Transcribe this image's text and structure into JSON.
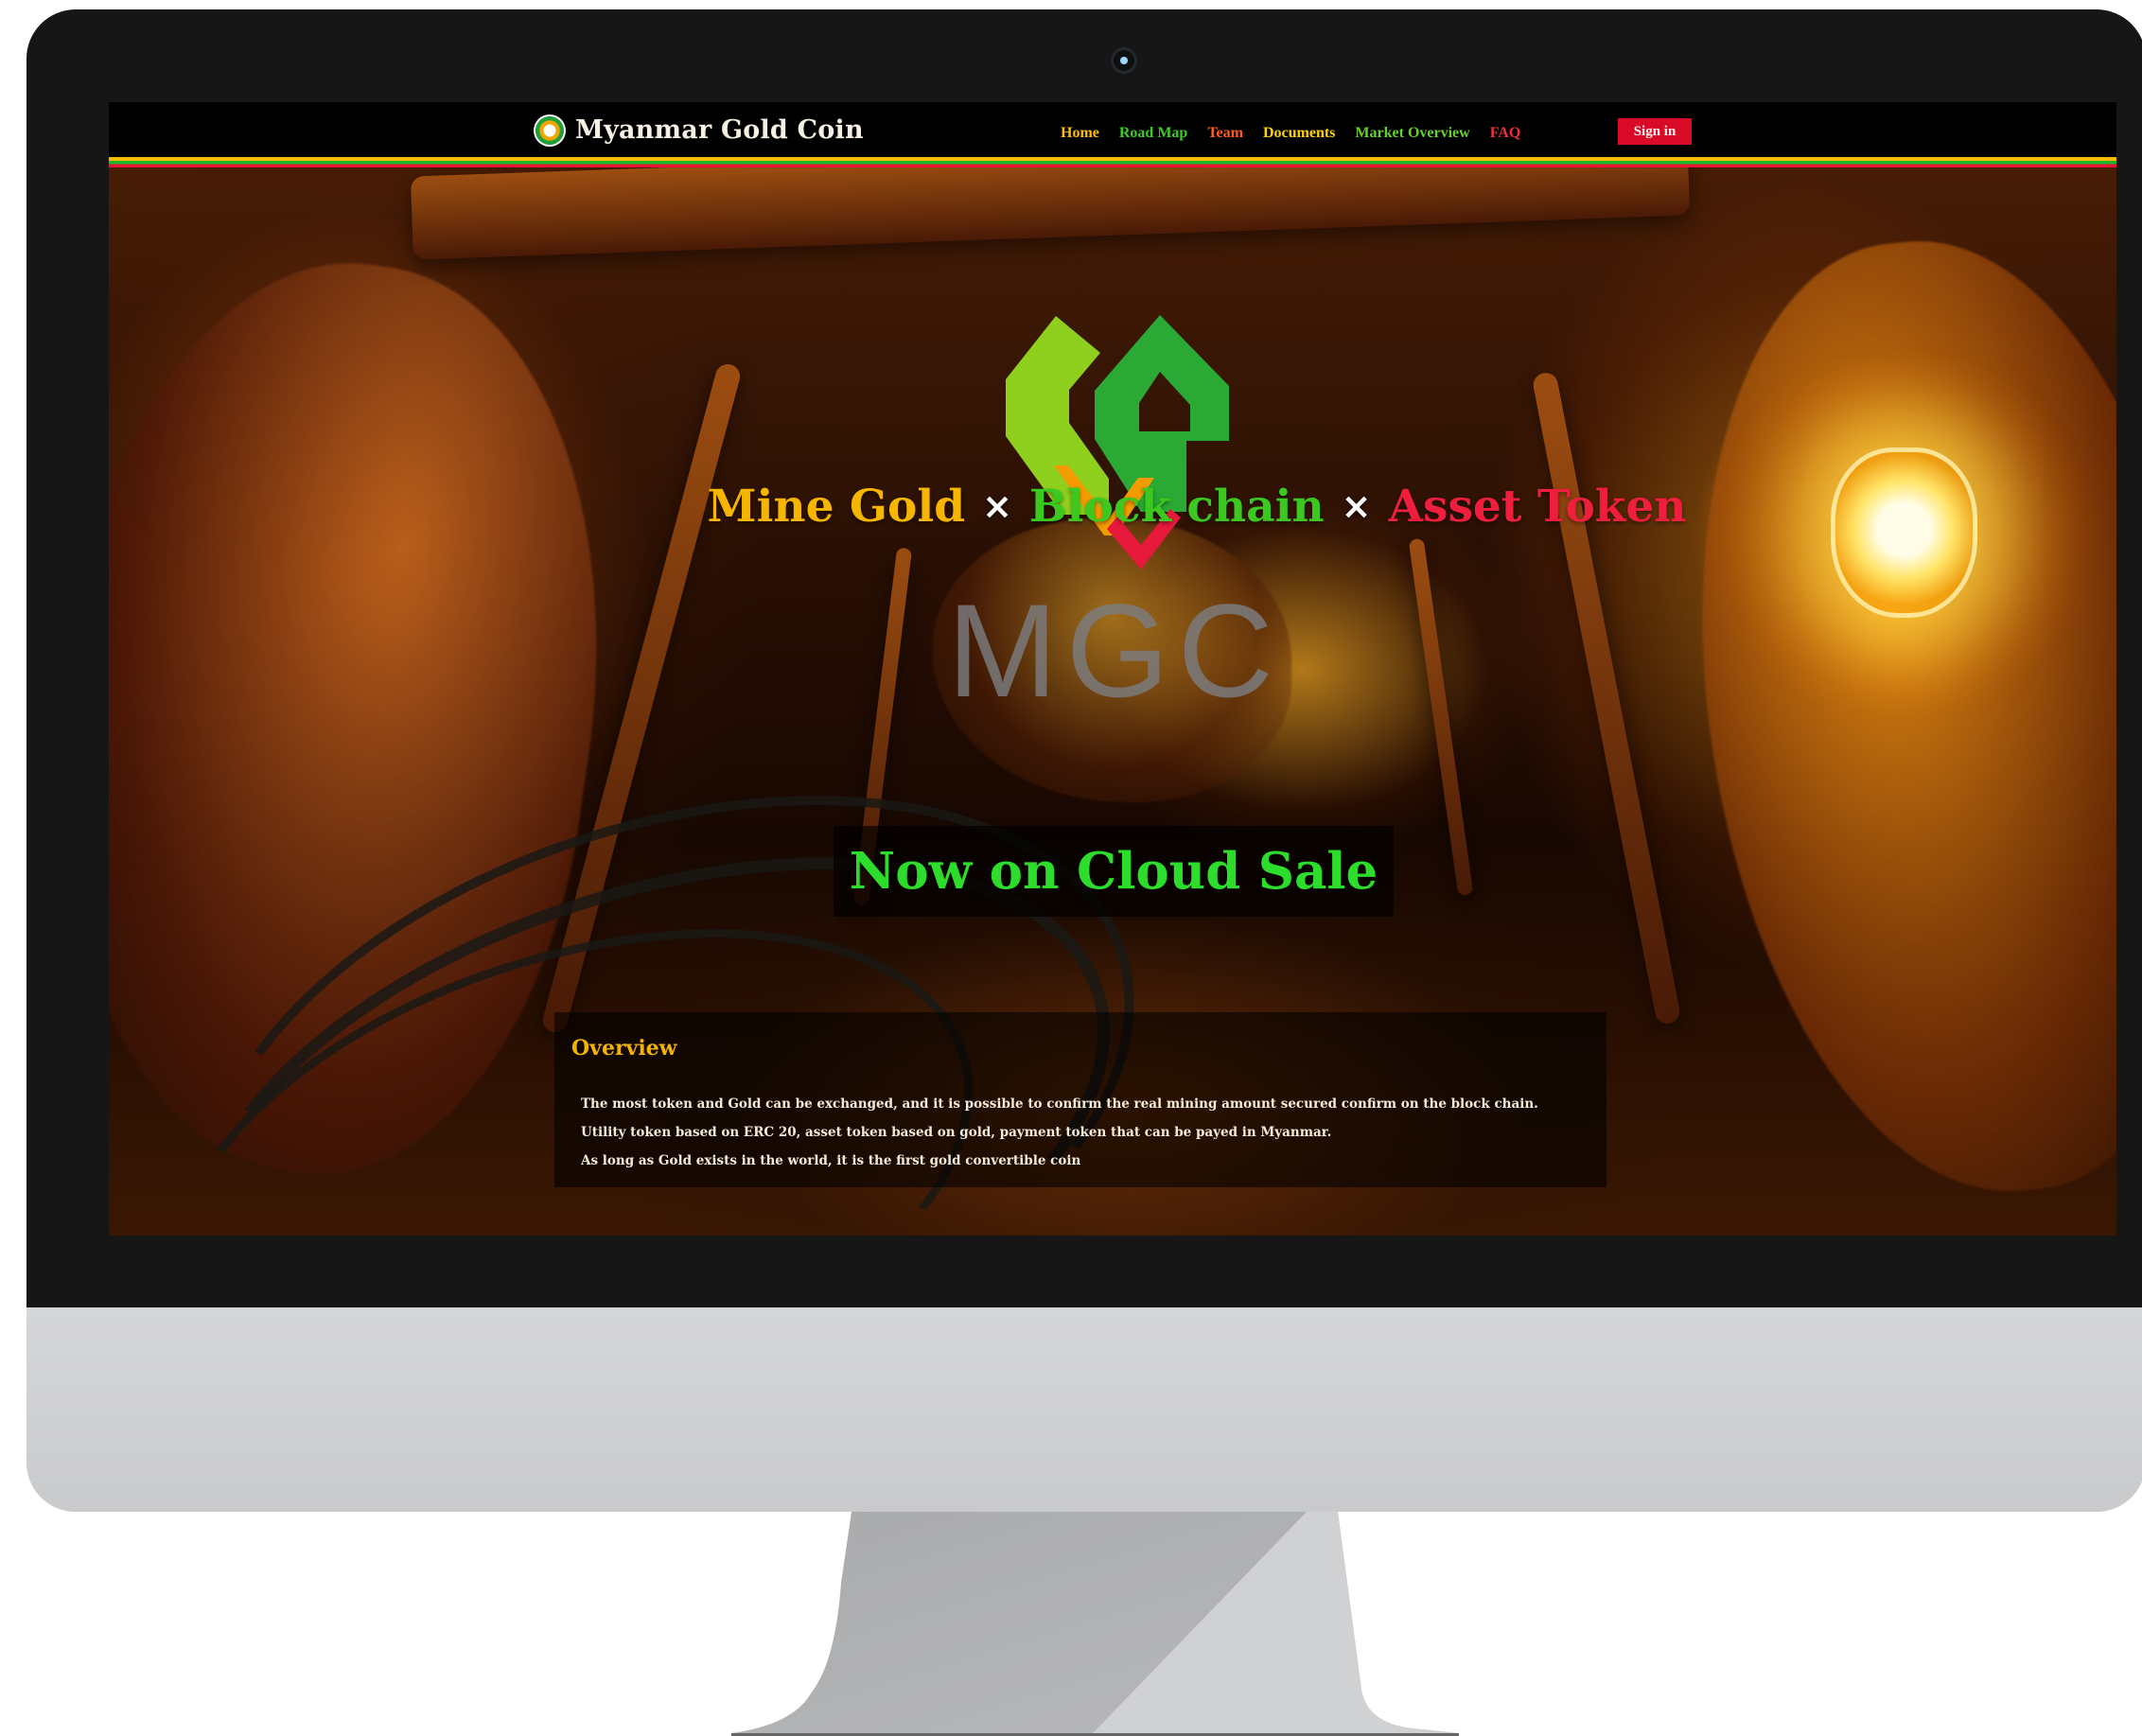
{
  "brand": {
    "name": "Myanmar Gold Coin",
    "logo_icon": "mgc-coin-icon"
  },
  "nav": {
    "items": [
      {
        "label": "Home",
        "color": "#ffbf00"
      },
      {
        "label": "Road Map",
        "color": "#3ecd24"
      },
      {
        "label": "Team",
        "color": "#ff5d1a"
      },
      {
        "label": "Documents",
        "color": "#ffd500"
      },
      {
        "label": "Market Overview",
        "color": "#66d228"
      },
      {
        "label": "FAQ",
        "color": "#f12e3b"
      }
    ],
    "signin_label": "Sign in"
  },
  "hero": {
    "tagline_parts": [
      "Mine Gold",
      "×",
      "Block chain",
      "×",
      "Asset Token"
    ],
    "logo_text": "MGC",
    "cta_label": "Now on Cloud Sale"
  },
  "overview": {
    "title": "Overview",
    "lines": [
      "The most token and Gold can be exchanged, and it is possible to confirm the real mining amount secured confirm on the block chain.",
      "Utility token based on ERC 20, asset token based on gold, payment token that can be payed in Myanmar.",
      "As long as Gold exists in the world, it is the first gold convertible coin"
    ]
  },
  "colors": {
    "gold": "#f6b600",
    "green": "#3cc91f",
    "red": "#f01e3d",
    "stripe_gold": "#f5bb00",
    "stripe_green": "#1bb729",
    "stripe_red": "#ea1235",
    "monitor_frame": "#d3d4d6",
    "monitor_bezel": "#161616"
  }
}
